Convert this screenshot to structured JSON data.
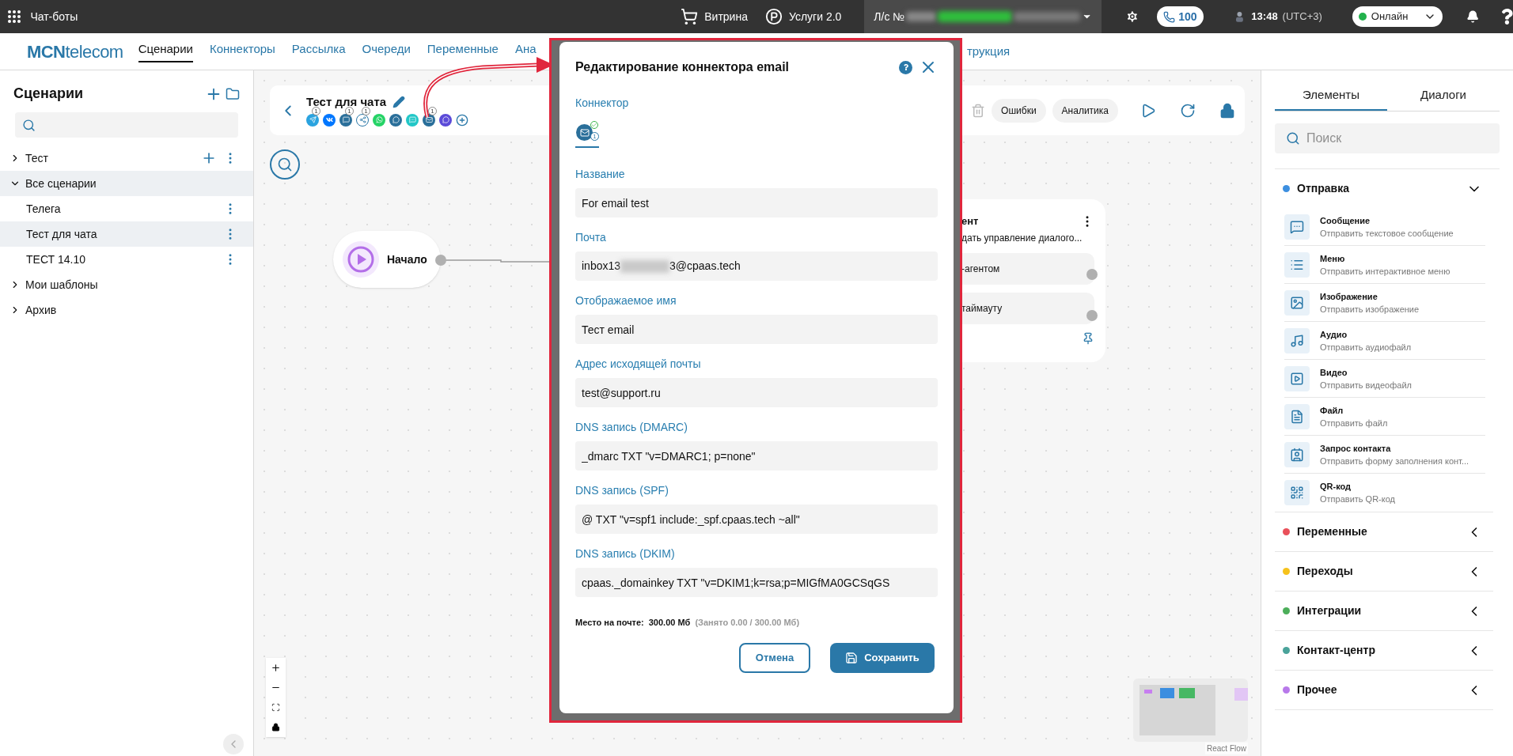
{
  "top_bar": {
    "app_title": "Чат-боты",
    "showcase": "Витрина",
    "services": "Услуги 2.0",
    "account_label": "Л/с №",
    "calls": "100",
    "time": "13:48",
    "timezone": "(UTC+3)",
    "status": "Онлайн"
  },
  "nav": {
    "logo_bold": "MCN",
    "logo_rest": "telecom",
    "items": [
      {
        "label": "Сценарии",
        "selected": true
      },
      {
        "label": "Коннекторы",
        "selected": false
      },
      {
        "label": "Рассылка",
        "selected": false
      },
      {
        "label": "Очереди",
        "selected": false
      },
      {
        "label": "Переменные",
        "selected": false
      },
      {
        "label": "Ана",
        "selected": false
      }
    ],
    "cut_item": "трукция"
  },
  "sidebar": {
    "title": "Сценарии",
    "tree": [
      {
        "label": "Тест",
        "expanded": false,
        "selected": false,
        "add_button": true,
        "menu": true
      },
      {
        "label": "Все сценарии",
        "expanded": true,
        "selected": true,
        "add_button": false,
        "menu": false,
        "children": [
          {
            "label": "Телега",
            "selected": false,
            "menu": true
          },
          {
            "label": "Тест для чата",
            "selected": true,
            "menu": true
          },
          {
            "label": "ТЕСТ 14.10",
            "selected": false,
            "menu": true
          }
        ]
      },
      {
        "label": "Мои шаблоны",
        "expanded": false,
        "selected": false,
        "add_button": false,
        "menu": false
      },
      {
        "label": "Архив",
        "expanded": false,
        "selected": false,
        "add_button": false,
        "menu": false
      }
    ]
  },
  "canvas": {
    "header": {
      "title": "Тест для чата",
      "channels": [
        {
          "kind": "telegram",
          "badge": "1"
        },
        {
          "kind": "vk"
        },
        {
          "kind": "chat",
          "badge": "1"
        },
        {
          "kind": "share",
          "badge": "1"
        },
        {
          "kind": "whatsapp"
        },
        {
          "kind": "chat2"
        },
        {
          "kind": "sms"
        },
        {
          "kind": "email",
          "badge": "1"
        },
        {
          "kind": "viber"
        },
        {
          "kind": "add"
        }
      ],
      "actions": [
        "Ошибки",
        "Аналитика"
      ]
    },
    "start_node": {
      "label": "Начало"
    },
    "agent_node": {
      "title": "ент",
      "subtitle": "дать управление диалого...",
      "ports": [
        "-агентом",
        "таймауту"
      ]
    },
    "attribution": "React Flow"
  },
  "modal": {
    "title": "Редактирование коннектора email",
    "connector_label": "Коннектор",
    "connector_tab": {
      "badge": "1",
      "selected": true
    },
    "fields": [
      {
        "kind": "text",
        "label": "Название",
        "value": "For email test"
      },
      {
        "kind": "masked",
        "label": "Почта",
        "value_start": "inbox13",
        "value_end": "3@cpaas.tech"
      },
      {
        "kind": "text",
        "label": "Отображаемое имя",
        "value": "Тест email"
      },
      {
        "kind": "text",
        "label": "Адрес исходящей почты",
        "value": "test@support.ru"
      },
      {
        "kind": "text",
        "label": "DNS запись (DMARC)",
        "value": "_dmarc TXT \"v=DMARC1; p=none\""
      },
      {
        "kind": "text",
        "label": "DNS запись (SPF)",
        "value": "@ TXT \"v=spf1 include:_spf.cpaas.tech ~all\""
      },
      {
        "kind": "text",
        "label": "DNS запись (DKIM)",
        "value": "cpaas._domainkey TXT \"v=DKIM1;k=rsa;p=MIGfMA0GCSqGS"
      }
    ],
    "storage": {
      "label": "Место на почте:",
      "value": "300.00 Мб",
      "detail": "(Занято 0.00 / 300.00 Мб)"
    },
    "cancel": "Отмена",
    "save": "Сохранить"
  },
  "right_panel": {
    "tabs": [
      {
        "label": "Элементы",
        "selected": true
      },
      {
        "label": "Диалоги",
        "selected": false
      }
    ],
    "search": {
      "placeholder": "Поиск"
    },
    "groups": [
      {
        "label": "Отправка",
        "color": "#3d8fe0",
        "expanded": true,
        "items": [
          {
            "kind": "message",
            "title": "Сообщение",
            "subtitle": "Отправить текстовое сообщение"
          },
          {
            "kind": "menu",
            "title": "Меню",
            "subtitle": "Отправить интерактивное меню"
          },
          {
            "kind": "image",
            "title": "Изображение",
            "subtitle": "Отправить изображение"
          },
          {
            "kind": "audio",
            "title": "Аудио",
            "subtitle": "Отправить аудиофайл"
          },
          {
            "kind": "video",
            "title": "Видео",
            "subtitle": "Отправить видеофайл"
          },
          {
            "kind": "file",
            "title": "Файл",
            "subtitle": "Отправить файл"
          },
          {
            "kind": "contact",
            "title": "Запрос контакта",
            "subtitle": "Отправить форму заполнения конт..."
          },
          {
            "kind": "qr",
            "title": "QR-код",
            "subtitle": "Отправить QR-код"
          }
        ]
      },
      {
        "label": "Переменные",
        "color": "#e9505a",
        "expanded": false
      },
      {
        "label": "Переходы",
        "color": "#f6c21c",
        "expanded": false
      },
      {
        "label": "Интеграции",
        "color": "#4cae5a",
        "expanded": false
      },
      {
        "label": "Контакт-центр",
        "color": "#4aa39a",
        "expanded": false
      },
      {
        "label": "Прочее",
        "color": "#b879ea",
        "expanded": false
      }
    ]
  }
}
